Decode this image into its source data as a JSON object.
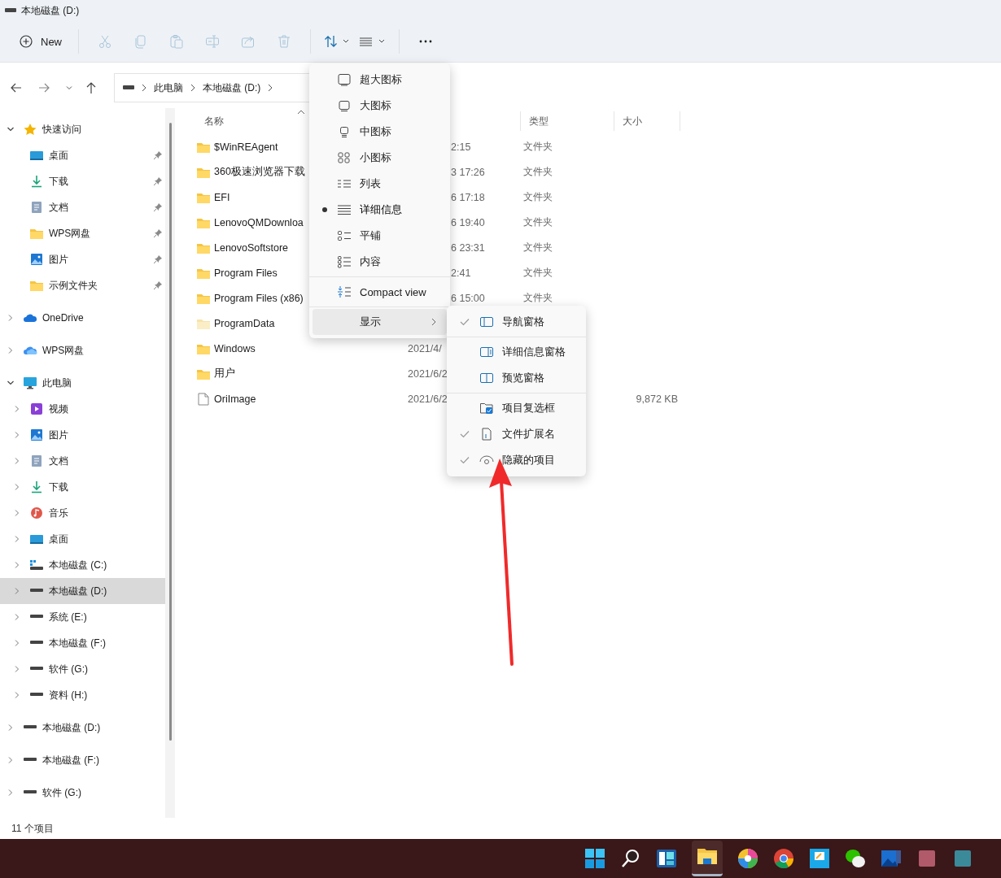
{
  "window": {
    "title": "本地磁盘 (D:)"
  },
  "toolbar": {
    "new_label": "New",
    "buttons": [
      {
        "kind": "cut",
        "disabled": true
      },
      {
        "kind": "copy",
        "disabled": true
      },
      {
        "kind": "paste",
        "disabled": true
      },
      {
        "kind": "rename",
        "disabled": true
      },
      {
        "kind": "share",
        "disabled": true
      },
      {
        "kind": "delete",
        "disabled": true
      },
      {
        "kind": "sort"
      },
      {
        "kind": "view"
      },
      {
        "kind": "more"
      }
    ]
  },
  "address_bar": {
    "path": [
      "此电脑",
      "本地磁盘 (D:)"
    ]
  },
  "sidebar": {
    "items": [
      {
        "label": "快速访问",
        "expanded": true,
        "selected": false,
        "children": [
          {
            "label": "桌面",
            "pinned": true,
            "selected": false
          },
          {
            "label": "下载",
            "pinned": true,
            "selected": false
          },
          {
            "label": "文档",
            "pinned": true,
            "selected": false
          },
          {
            "label": "WPS网盘",
            "pinned": true,
            "selected": false
          },
          {
            "label": "图片",
            "pinned": true,
            "selected": false
          },
          {
            "label": "示例文件夹",
            "pinned": true,
            "selected": false
          }
        ]
      },
      {
        "label": "OneDrive",
        "expanded": false,
        "selected": false
      },
      {
        "label": "WPS网盘",
        "expanded": false,
        "selected": false
      },
      {
        "label": "此电脑",
        "expanded": true,
        "selected": false,
        "children": [
          {
            "label": "视频",
            "expanded": false,
            "selected": false
          },
          {
            "label": "图片",
            "expanded": false,
            "selected": false
          },
          {
            "label": "文档",
            "expanded": false,
            "selected": false
          },
          {
            "label": "下载",
            "expanded": false,
            "selected": false
          },
          {
            "label": "音乐",
            "expanded": false,
            "selected": false
          },
          {
            "label": "桌面",
            "expanded": false,
            "selected": false
          },
          {
            "label": "本地磁盘 (C:)",
            "expanded": false,
            "selected": false
          },
          {
            "label": "本地磁盘 (D:)",
            "expanded": false,
            "selected": true
          },
          {
            "label": "系统 (E:)",
            "expanded": false,
            "selected": false
          },
          {
            "label": "本地磁盘 (F:)",
            "expanded": false,
            "selected": false
          },
          {
            "label": "软件 (G:)",
            "expanded": false,
            "selected": false
          },
          {
            "label": "资料 (H:)",
            "expanded": false,
            "selected": false
          }
        ]
      },
      {
        "label": "本地磁盘 (D:)",
        "expanded": false,
        "selected": false
      },
      {
        "label": "本地磁盘 (F:)",
        "expanded": false,
        "selected": false
      },
      {
        "label": "软件 (G:)",
        "expanded": false,
        "selected": false
      }
    ]
  },
  "file_list": {
    "columns": [
      "名称",
      "类型",
      "大小"
    ],
    "rows": [
      {
        "name": "$WinREAgent",
        "kind": "folder",
        "modified": "2:15",
        "type": "文件夹"
      },
      {
        "name": "360极速浏览器下载",
        "kind": "folder",
        "modified": "3 17:26",
        "type": "文件夹"
      },
      {
        "name": "EFI",
        "kind": "folder",
        "modified": "6 17:18",
        "type": "文件夹"
      },
      {
        "name": "LenovoQMDownloa",
        "kind": "folder",
        "modified": "6 19:40",
        "type": "文件夹"
      },
      {
        "name": "LenovoSoftstore",
        "kind": "folder",
        "modified": "6 23:31",
        "type": "文件夹"
      },
      {
        "name": "Program Files",
        "kind": "folder",
        "modified": "2:41",
        "type": "文件夹"
      },
      {
        "name": "Program Files (x86)",
        "kind": "folder",
        "modified": "6 15:00",
        "type": "文件夹"
      },
      {
        "name": "ProgramData",
        "kind": "hidden-folder"
      },
      {
        "name": "Windows",
        "kind": "folder",
        "modified": "2021/4/"
      },
      {
        "name": "用户",
        "kind": "folder",
        "modified": "2021/6/2"
      },
      {
        "name": "OriImage",
        "kind": "file",
        "modified": "2021/6/2",
        "size": "9,872 KB"
      }
    ]
  },
  "view_menu": {
    "items": [
      {
        "kind": "option",
        "label": "超大图标",
        "selected": false
      },
      {
        "kind": "option",
        "label": "大图标",
        "selected": false
      },
      {
        "kind": "option",
        "label": "中图标",
        "selected": false
      },
      {
        "kind": "option",
        "label": "小图标",
        "selected": false
      },
      {
        "kind": "option",
        "label": "列表",
        "selected": false
      },
      {
        "kind": "option",
        "label": "详细信息",
        "selected": true
      },
      {
        "kind": "option",
        "label": "平铺",
        "selected": false
      },
      {
        "kind": "option",
        "label": "内容",
        "selected": false
      },
      {
        "kind": "toggle",
        "label": "Compact view"
      },
      {
        "kind": "submenu",
        "label": "显示",
        "expanded": true
      }
    ]
  },
  "show_submenu": {
    "items": [
      {
        "label": "导航窗格",
        "checked": true
      },
      {
        "label": "详细信息窗格",
        "checked": false
      },
      {
        "label": "预览窗格",
        "checked": false
      },
      {
        "label": "项目复选框",
        "checked": false
      },
      {
        "label": "文件扩展名",
        "checked": true
      },
      {
        "label": "隐藏的项目",
        "checked": true
      }
    ]
  },
  "status_bar": {
    "item_count": "11 个项目"
  }
}
